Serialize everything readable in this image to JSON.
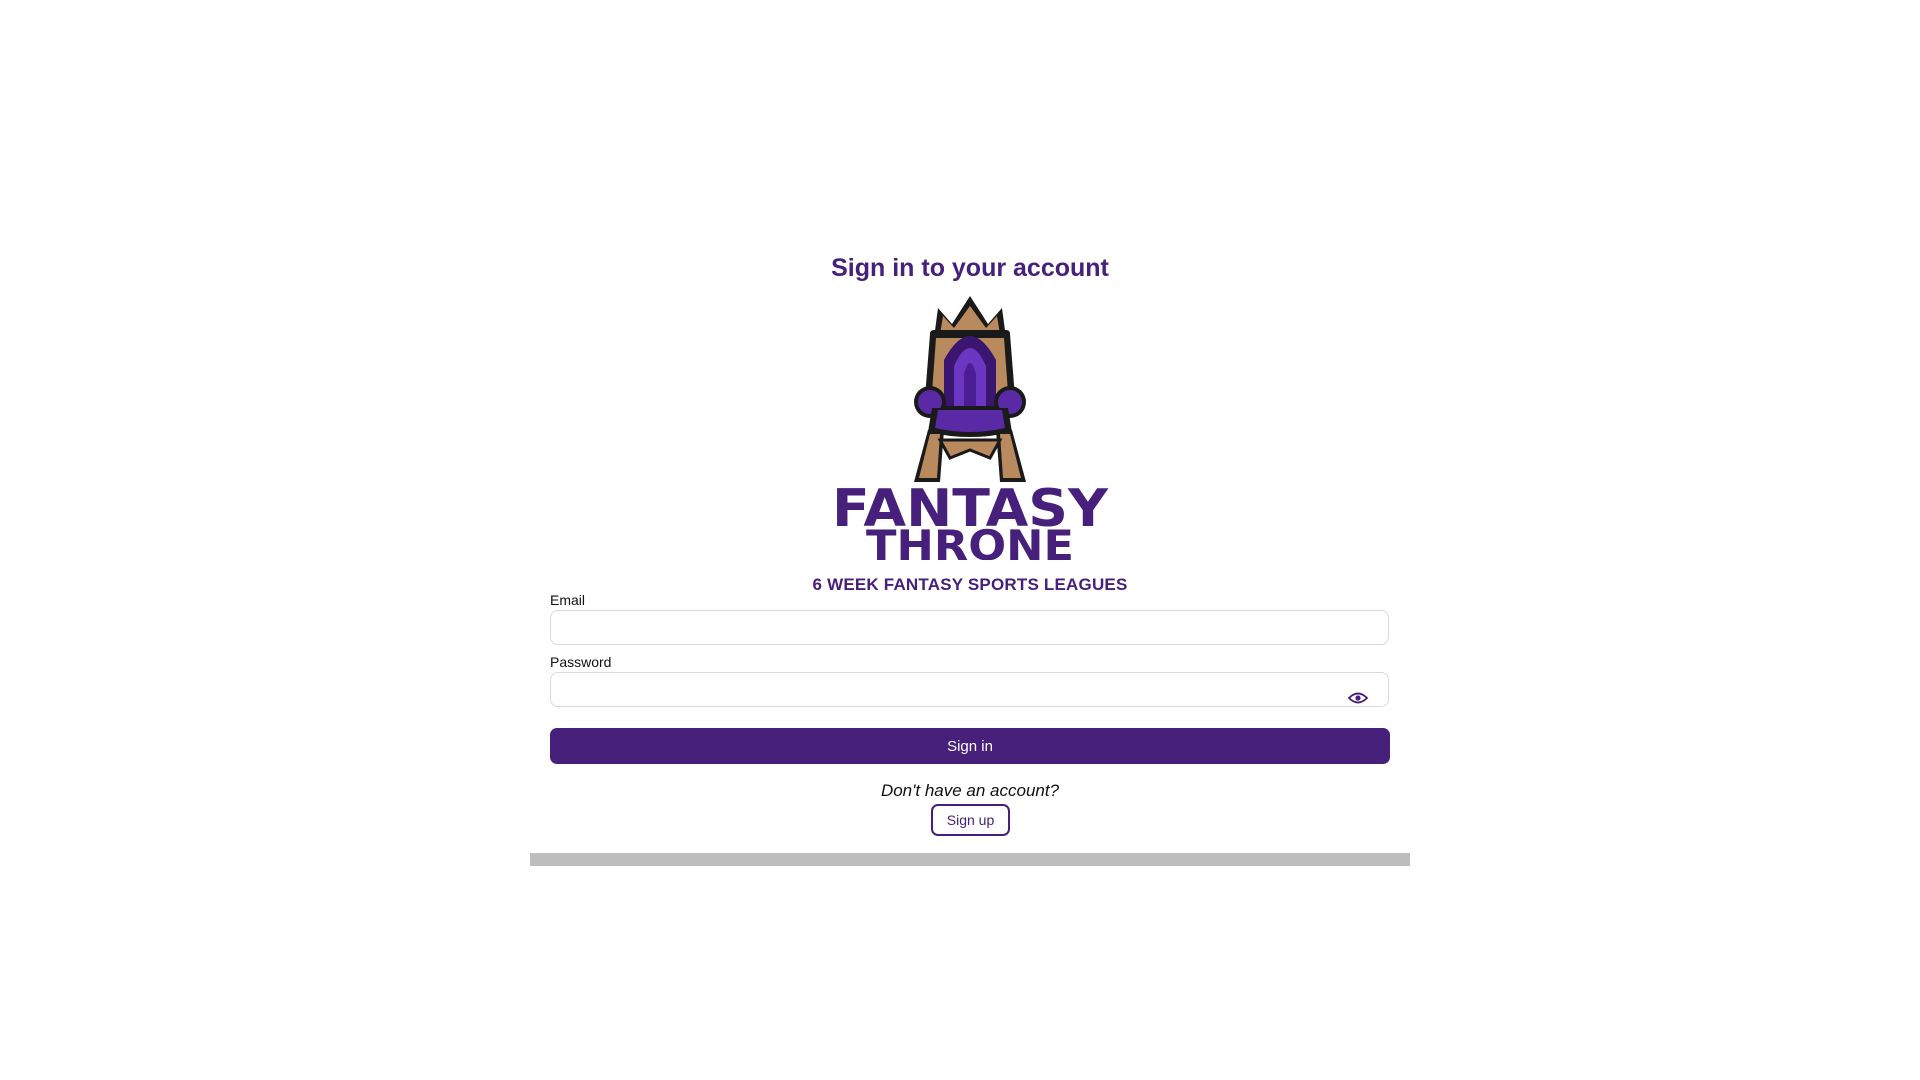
{
  "title": "Sign in to your account",
  "logo": {
    "icon": "throne-logo-icon",
    "line1": "FANTASY",
    "line2": "THRONE"
  },
  "tagline": "6 WEEK FANTASY SPORTS LEAGUES",
  "form": {
    "email_label": "Email",
    "email_value": "",
    "password_label": "Password",
    "password_value": "",
    "password_toggle_icon": "eye-icon",
    "signin_label": "Sign in"
  },
  "footer": {
    "prompt": "Don't have an account?",
    "signup_label": "Sign up"
  },
  "colors": {
    "brand_purple": "#46207a",
    "throne_wood": "#b98a5e",
    "throne_cushion": "#5a2aa6",
    "bar_gray": "#bdbdbd"
  }
}
